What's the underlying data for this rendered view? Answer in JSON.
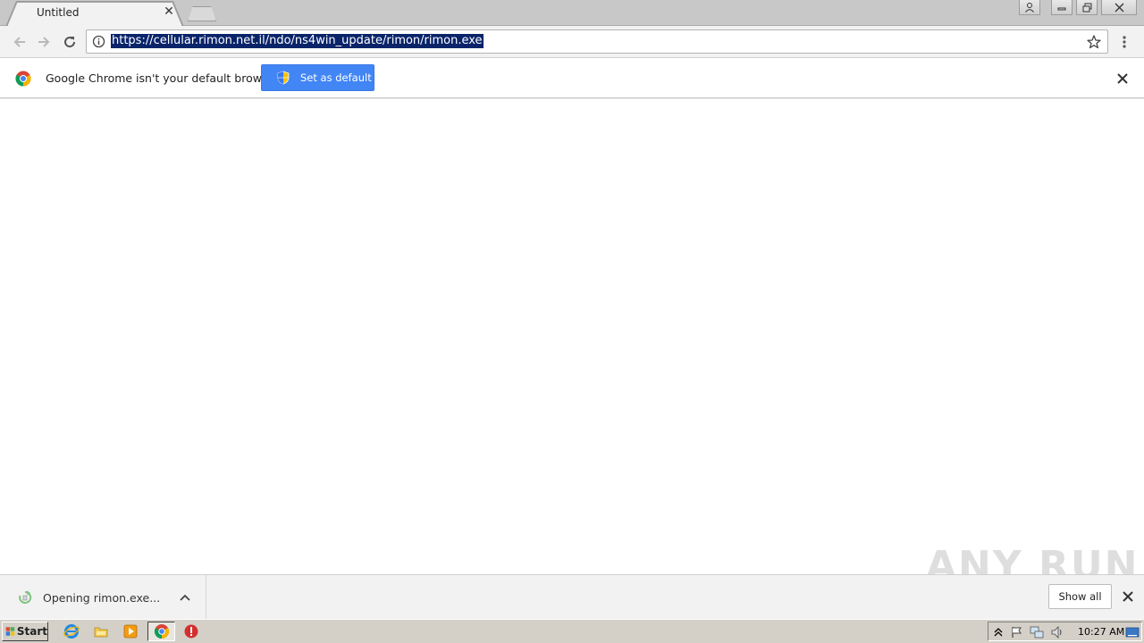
{
  "browser": {
    "tab_title": "Untitled",
    "url": "https://cellular.rimon.net.il/ndo/ns4win_update/rimon/rimon.exe"
  },
  "infobar": {
    "message": "Google Chrome isn't your default browser",
    "button_label": "Set as default"
  },
  "download_shelf": {
    "item_label": "Opening rimon.exe...",
    "show_all_label": "Show all"
  },
  "watermark": "ANY RUN",
  "taskbar": {
    "start_label": "Start",
    "clock": "10:27 AM"
  },
  "colors": {
    "accent_blue": "#4285f4",
    "url_selection": "#0a246a",
    "taskbar": "#d4d0c8"
  }
}
